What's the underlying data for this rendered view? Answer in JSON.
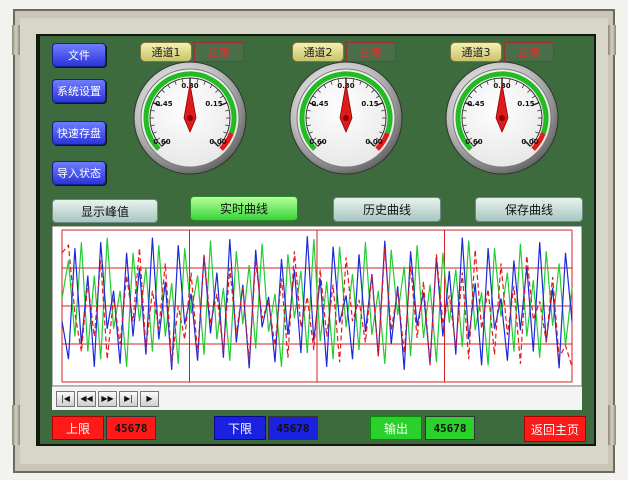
{
  "menu": {
    "file": "文件",
    "system_settings": "系统设置",
    "quick_save": "快速存盘",
    "import_status": "导入状态"
  },
  "channels": [
    {
      "label": "通道1",
      "status": "正常",
      "needle_value": 0.3
    },
    {
      "label": "通道2",
      "status": "正常",
      "needle_value": 0.3
    },
    {
      "label": "通道3",
      "status": "正常",
      "needle_value": 0.3
    }
  ],
  "gauge_ticks": [
    "0.30",
    "0.45",
    "0.15",
    "0.60",
    "0.00"
  ],
  "tabs": {
    "peak": "显示峰值",
    "realtime": "实时曲线",
    "history": "历史曲线",
    "save": "保存曲线"
  },
  "media_controls": [
    "first-icon",
    "rewind-icon",
    "fast-forward-icon",
    "last-icon",
    "play-icon"
  ],
  "bottom": {
    "upper_label": "上限",
    "upper_value": "45678",
    "lower_label": "下限",
    "lower_value": "45678",
    "output_label": "输出",
    "output_value": "45678",
    "home": "返回主页"
  },
  "colors": {
    "panel": "#3e6b3e",
    "accent_blue": "#2b35d8",
    "accent_green": "#2ad12a",
    "accent_red": "#ff1a1a",
    "series_green": "#22cc33",
    "series_blue": "#1a2ad8",
    "series_red": "#e01b1b"
  },
  "chart_data": {
    "type": "line",
    "x": [
      0,
      1,
      2,
      3,
      4,
      5,
      6,
      7,
      8,
      9,
      10,
      11,
      12,
      13,
      14,
      15,
      16,
      17,
      18,
      19,
      20,
      21,
      22,
      23,
      24,
      25,
      26,
      27,
      28,
      29,
      30,
      31,
      32,
      33,
      34,
      35,
      36,
      37,
      38,
      39,
      40,
      41,
      42,
      43,
      44,
      45,
      46,
      47,
      48,
      49,
      50,
      51,
      52,
      53,
      54,
      55,
      56,
      57,
      58,
      59,
      60,
      61,
      62,
      63,
      64,
      65,
      66,
      67,
      68,
      69,
      70,
      71,
      72,
      73,
      74,
      75,
      76,
      77,
      78,
      79
    ],
    "ylim": [
      0,
      1
    ],
    "grid": true,
    "series": [
      {
        "color": "green",
        "dash": "solid",
        "values": [
          0.55,
          0.8,
          0.3,
          0.92,
          0.2,
          0.7,
          0.15,
          0.95,
          0.35,
          0.6,
          0.1,
          0.85,
          0.4,
          0.75,
          0.2,
          0.9,
          0.3,
          0.65,
          0.12,
          0.88,
          0.45,
          0.7,
          0.18,
          0.93,
          0.28,
          0.62,
          0.14,
          0.86,
          0.38,
          0.77,
          0.22,
          0.91,
          0.33,
          0.58,
          0.1,
          0.84,
          0.42,
          0.73,
          0.19,
          0.94,
          0.27,
          0.66,
          0.15,
          0.89,
          0.36,
          0.71,
          0.21,
          0.92,
          0.31,
          0.6,
          0.12,
          0.87,
          0.44,
          0.76,
          0.17,
          0.9,
          0.29,
          0.64,
          0.13,
          0.85,
          0.39,
          0.74,
          0.23,
          0.93,
          0.34,
          0.59,
          0.11,
          0.88,
          0.43,
          0.72,
          0.2,
          0.91,
          0.3,
          0.67,
          0.16,
          0.86,
          0.37,
          0.78,
          0.24,
          0.62
        ]
      },
      {
        "color": "blue",
        "dash": "solid",
        "values": [
          0.4,
          0.15,
          0.88,
          0.25,
          0.7,
          0.1,
          0.92,
          0.35,
          0.6,
          0.12,
          0.85,
          0.3,
          0.75,
          0.18,
          0.95,
          0.28,
          0.66,
          0.08,
          0.9,
          0.38,
          0.58,
          0.14,
          0.83,
          0.32,
          0.72,
          0.16,
          0.94,
          0.26,
          0.64,
          0.09,
          0.87,
          0.36,
          0.56,
          0.13,
          0.81,
          0.31,
          0.74,
          0.19,
          0.96,
          0.27,
          0.68,
          0.1,
          0.89,
          0.39,
          0.57,
          0.15,
          0.84,
          0.33,
          0.71,
          0.17,
          0.93,
          0.25,
          0.63,
          0.08,
          0.86,
          0.37,
          0.59,
          0.12,
          0.82,
          0.3,
          0.73,
          0.18,
          0.95,
          0.28,
          0.65,
          0.11,
          0.88,
          0.35,
          0.55,
          0.14,
          0.8,
          0.34,
          0.76,
          0.2,
          0.92,
          0.26,
          0.62,
          0.09,
          0.85,
          0.4
        ]
      },
      {
        "color": "red",
        "dash": "dashed",
        "values": [
          0.85,
          0.9,
          0.45,
          0.2,
          0.65,
          0.3,
          0.8,
          0.15,
          0.55,
          0.25,
          0.7,
          0.4,
          0.88,
          0.22,
          0.6,
          0.35,
          0.78,
          0.12,
          0.5,
          0.28,
          0.72,
          0.18,
          0.84,
          0.38,
          0.58,
          0.2,
          0.75,
          0.32,
          0.62,
          0.14,
          0.8,
          0.42,
          0.52,
          0.24,
          0.68,
          0.16,
          0.86,
          0.36,
          0.56,
          0.21,
          0.74,
          0.3,
          0.64,
          0.13,
          0.82,
          0.4,
          0.54,
          0.26,
          0.7,
          0.17,
          0.88,
          0.34,
          0.6,
          0.19,
          0.76,
          0.29,
          0.66,
          0.11,
          0.84,
          0.38,
          0.57,
          0.23,
          0.72,
          0.15,
          0.87,
          0.35,
          0.61,
          0.18,
          0.78,
          0.31,
          0.63,
          0.12,
          0.83,
          0.41,
          0.53,
          0.27,
          0.69,
          0.16,
          0.24,
          0.1
        ]
      }
    ]
  }
}
